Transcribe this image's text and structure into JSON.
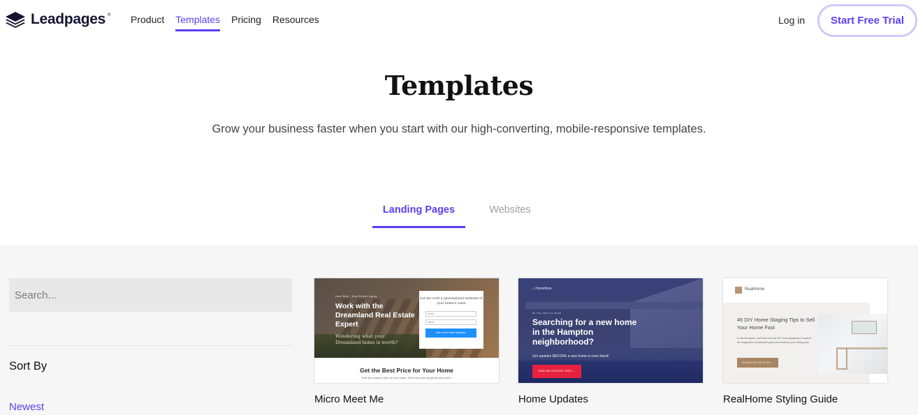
{
  "header": {
    "brand": "Leadpages",
    "brand_mark": "®",
    "nav": [
      {
        "label": "Product",
        "active": false
      },
      {
        "label": "Templates",
        "active": true
      },
      {
        "label": "Pricing",
        "active": false
      },
      {
        "label": "Resources",
        "active": false
      }
    ],
    "login_label": "Log in",
    "cta_label": "Start Free Trial"
  },
  "hero": {
    "title": "Templates",
    "subtitle": "Grow your business faster when you start with our high-converting, mobile-responsive templates."
  },
  "tabs": [
    {
      "label": "Landing Pages",
      "active": true
    },
    {
      "label": "Websites",
      "active": false
    }
  ],
  "sidebar": {
    "search_placeholder": "Search...",
    "sort_label": "Sort By",
    "sort_options": [
      {
        "label": "Newest",
        "active": true
      }
    ]
  },
  "templates": [
    {
      "name": "Micro Meet Me",
      "preview": {
        "eyebrow": "Jane Rule - Real Estate Agent",
        "headline": "Work with the Dreamland Real Estate Expert",
        "subhead": "Wondering what your Dreamland home is worth?",
        "form_title": "Let me craft a personalized estimate of your home's value",
        "field_email": "Email",
        "field_name": "Name",
        "button": "Get a Free Home Valuation",
        "section_title": "Get the Best Price for Your Home",
        "section_text": "Find the market value of your home. We'll visit your property and craft a"
      }
    },
    {
      "name": "Home Updates",
      "preview": {
        "logo": "HomeNow",
        "eyebrow": "BE THE FIRST TO KNOW",
        "headline": "Searching for a new home in the Hampton neighborhood?",
        "subhead": "Get updates BEFORE a new home is even listed!",
        "button": "SEND ME UPDATES FIRST →"
      }
    },
    {
      "name": "RealHome Styling Guide",
      "preview": {
        "logo": "RealHome",
        "headline": "45 DIY Home Staging Tips to Sell Your Home Fast",
        "body": "In this free guide, you'll learn the top DIY home styling tips to capture the imagination of potential buyers and maximize your selling price.",
        "button": "DOWNLOAD THE GUIDE →"
      }
    }
  ],
  "colors": {
    "accent": "#5b3ff5",
    "cta_border": "#d2c9fb",
    "section_bg": "#f6f6f6",
    "search_bg": "#e8e8e8"
  }
}
